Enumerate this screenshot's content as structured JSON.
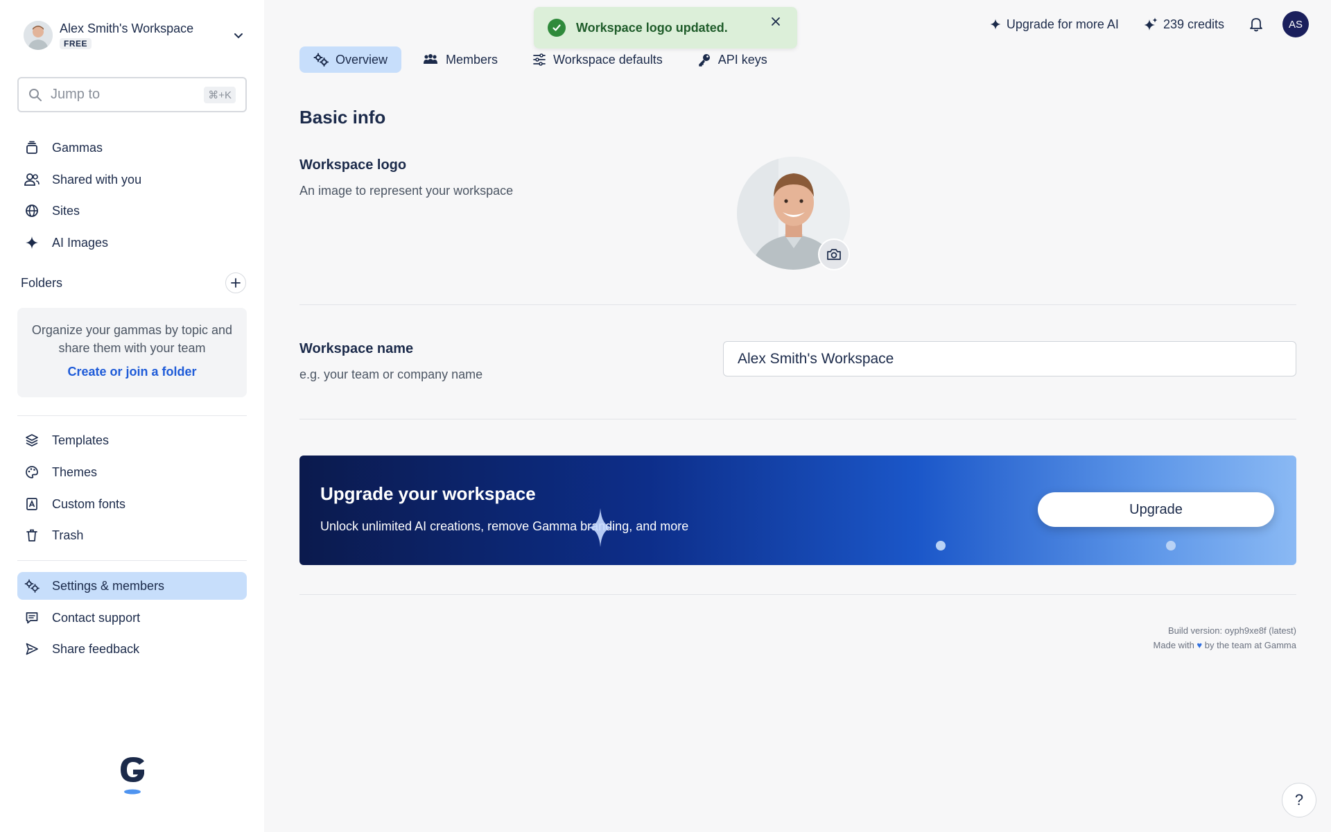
{
  "sidebar": {
    "workspace": {
      "name": "Alex Smith's Workspace",
      "plan": "FREE"
    },
    "search": {
      "placeholder": "Jump to",
      "shortcut": "⌘+K"
    },
    "nav_main": [
      {
        "label": "Gammas",
        "icon": "stack-icon"
      },
      {
        "label": "Shared with you",
        "icon": "people-icon"
      },
      {
        "label": "Sites",
        "icon": "globe-icon"
      },
      {
        "label": "AI Images",
        "icon": "sparkle-icon"
      }
    ],
    "folders": {
      "title": "Folders",
      "empty_text": "Organize your gammas by topic and share them with your team",
      "link": "Create or join a folder"
    },
    "nav_tools": [
      {
        "label": "Templates",
        "icon": "layers-icon"
      },
      {
        "label": "Themes",
        "icon": "palette-icon"
      },
      {
        "label": "Custom fonts",
        "icon": "font-icon"
      },
      {
        "label": "Trash",
        "icon": "trash-icon"
      }
    ],
    "nav_bottom": [
      {
        "label": "Settings & members",
        "icon": "gears-icon",
        "active": true
      },
      {
        "label": "Contact support",
        "icon": "chat-icon"
      },
      {
        "label": "Share feedback",
        "icon": "send-icon"
      }
    ]
  },
  "toast": {
    "message": "Workspace logo updated."
  },
  "topbar": {
    "upgrade_label": "Upgrade for more AI",
    "credits_label": "239 credits",
    "user_initials": "AS"
  },
  "tabs": [
    {
      "label": "Overview",
      "active": true
    },
    {
      "label": "Members"
    },
    {
      "label": "Workspace defaults"
    },
    {
      "label": "API keys"
    }
  ],
  "main": {
    "section_title": "Basic info",
    "logo_field": {
      "title": "Workspace logo",
      "description": "An image to represent your workspace"
    },
    "name_field": {
      "title": "Workspace name",
      "description": "e.g. your team or company name",
      "value": "Alex Smith's Workspace"
    },
    "banner": {
      "title": "Upgrade your workspace",
      "description": "Unlock unlimited AI creations, remove Gamma branding, and more",
      "button": "Upgrade"
    },
    "footer": {
      "build": "Build version: oyph9xe8f (latest)",
      "made_with_prefix": "Made with",
      "made_with_suffix": "by the team at Gamma"
    }
  },
  "help_label": "?",
  "colors": {
    "accent": "#c7defb",
    "link": "#1e5bd8",
    "text": "#1b2a4a",
    "toast_bg": "#dcefd9",
    "success": "#2f8a3b"
  }
}
